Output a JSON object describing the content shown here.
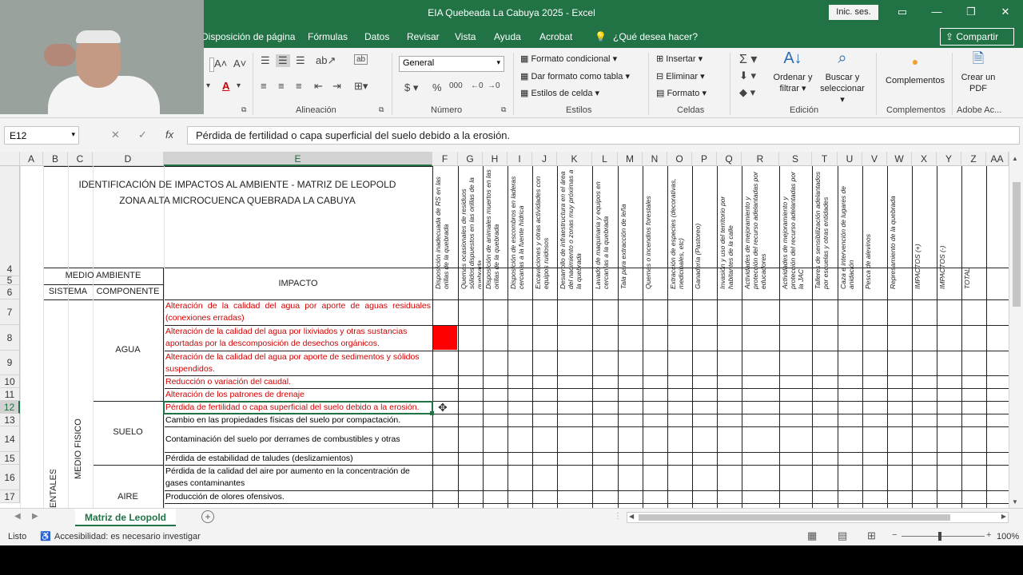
{
  "window": {
    "title": "EIA Quebeada La Cabuya 2025  -  Excel",
    "signin_label": "Inic. ses."
  },
  "ribbon_tabs": [
    "Disposición de página",
    "Fórmulas",
    "Datos",
    "Revisar",
    "Vista",
    "Ayuda",
    "Acrobat",
    "¿Qué desea hacer?"
  ],
  "share_label": "Compartir",
  "ribbon": {
    "alignment_label": "Alineación",
    "number_label": "Número",
    "number_format": "General",
    "styles_label": "Estilos",
    "cond_format": "Formato condicional",
    "table_format": "Dar formato como tabla",
    "cell_styles": "Estilos de celda",
    "cells_label": "Celdas",
    "insert": "Insertar",
    "delete": "Eliminar",
    "format": "Formato",
    "editing_label": "Edición",
    "sort_filter": "Ordenar y filtrar",
    "find_select": "Buscar y seleccionar",
    "addins": "Complementos",
    "addins_label": "Complementos",
    "create_pdf": "Crear un PDF",
    "adobe_label": "Adobe Ac..."
  },
  "formula_bar": {
    "name_box": "E12",
    "formula": "Pérdida de fertilidad o capa superficial del suelo debido a la erosión."
  },
  "columns": [
    "A",
    "B",
    "C",
    "D",
    "E",
    "F",
    "G",
    "H",
    "I",
    "J",
    "K",
    "L",
    "M",
    "N",
    "O",
    "P",
    "Q",
    "R",
    "S",
    "T",
    "U",
    "V",
    "W",
    "X",
    "Y",
    "Z",
    "AA"
  ],
  "rows": [
    "4",
    "5",
    "6",
    "7",
    "8",
    "9",
    "10",
    "11",
    "12",
    "13",
    "14",
    "15",
    "16",
    "17"
  ],
  "sheet": {
    "title1": "IDENTIFICACIÓN DE IMPACTOS AL AMBIENTE - MATRIZ DE LEOPOLD",
    "title2": "ZONA ALTA MICROCUENCA QUEBRADA LA CABUYA",
    "medio_ambiente": "MEDIO AMBIENTE",
    "sistema": "SISTEMA",
    "componente": "COMPONENTE",
    "impacto": "IMPACTO",
    "medio_fisico": "MEDIO FÍSICO",
    "sistema_partial": "ENTALES",
    "components": {
      "agua": "AGUA",
      "suelo": "SUELO",
      "aire": "AIRE"
    },
    "activities": [
      "Disposición inadecuada de RS en las orillas de la quebrada",
      "Quemas ocasionales de residuos sólidos dispuestos en las orillas de la quebrada",
      "Disposición de animales muertos en las orillas de la quebrada",
      "Disposición de escombros en laderas cercanas a la fuente hídrica",
      "Excavaciones y otras actividades con equipos ruidosos",
      "Desarrollo de infraestructura en el área del nacimiento o zonas muy próximas a la quebrada",
      "Lavado de maquinaria y equipos en cercanías a la quebrada",
      "Tala para extracción de leña",
      "Quemas o incendios forestales",
      "Extracción de especies (decorativas, medicinales, etc)",
      "Ganadería (Pastoreo)",
      "Invasión y uso del territorio por habitantes de la calle",
      "Actividades de mejoramiento y protección del recurso adelantadas por educadores",
      "Actividades de mejoramiento y protección del recurso adelantadas por la JAC",
      "Talleres de sensibilización adelantados por escuelas y otras entidades",
      "Caza e intervención de lugares de anidación",
      "Pesca de alevinos",
      "Represamiento de la quebrada",
      "IMPACTOS (+)",
      "IMPACTOS (-)",
      "TOTAL"
    ],
    "impacts": [
      "Alteración de la calidad del agua por aporte de aguas residuales (conexiones erradas)",
      "Alteración de la calidad del agua por lixiviados y otras sustancias aportadas por la descomposición de desechos orgánicos.",
      "Alteración de la calidad del agua por aporte de sedimentos y sólidos suspendidos.",
      "Reducción o variación del caudal.",
      "Alteración de los patrones de drenaje",
      "Pérdida de fertilidad o capa superficial del suelo debido a la erosión.",
      "Cambio en las propiedades físicas del suelo por compactación.",
      "Contaminación del suelo por derrames de combustibles y otras sustancias.",
      "Pérdida de estabilidad de taludes (deslizamientos)",
      "Pérdida de la calidad del aire por aumento en la concentración de gases contaminantes",
      "Producción de olores ofensivos."
    ]
  },
  "sheet_tab": "Matriz de Leopold",
  "status": {
    "ready": "Listo",
    "accessibility": "Accesibilidad: es necesario investigar",
    "zoom": "100%"
  },
  "colors": {
    "excel_green": "#217346",
    "marked_cell": "#ff0000",
    "impact_red": "#d40000"
  }
}
